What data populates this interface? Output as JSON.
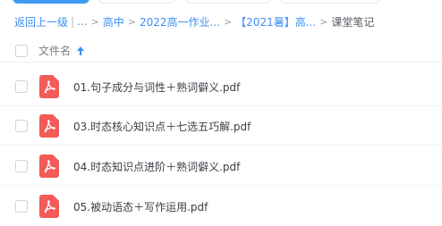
{
  "breadcrumb": {
    "back_label": "返回上一级",
    "ellipsis": "...",
    "items": [
      "高中",
      "2022高一作业...",
      "【2021暑】高..."
    ],
    "current": "课堂笔记"
  },
  "list_header": {
    "name_label": "文件名"
  },
  "files": [
    {
      "name": "01.句子成分与词性＋熟词僻义.pdf",
      "icon": "pdf-icon"
    },
    {
      "name": "03.时态核心知识点＋七选五巧解.pdf",
      "icon": "pdf-icon"
    },
    {
      "name": "04.时态知识点进阶＋熟词僻义.pdf",
      "icon": "pdf-icon"
    },
    {
      "name": "05.被动语态＋写作运用.pdf",
      "icon": "pdf-icon"
    }
  ],
  "colors": {
    "accent": "#3d8ff0",
    "pdf_red": "#f25b57"
  }
}
